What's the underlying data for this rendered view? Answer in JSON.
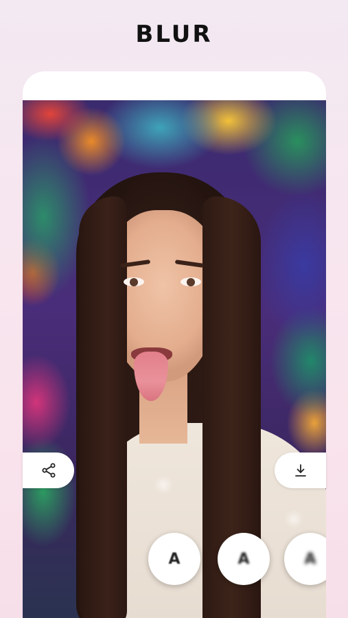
{
  "header": {
    "title": "BLUR"
  },
  "actions": {
    "share_icon": "share-icon",
    "download_icon": "download-icon"
  },
  "blur_levels": [
    {
      "label": "A"
    },
    {
      "label": "A"
    },
    {
      "label": "A"
    }
  ],
  "colors": {
    "background_top": "#f2e9f2",
    "background_bottom": "#f7dfe9",
    "title": "#111111",
    "card": "#ffffff",
    "icon": "#222222"
  }
}
